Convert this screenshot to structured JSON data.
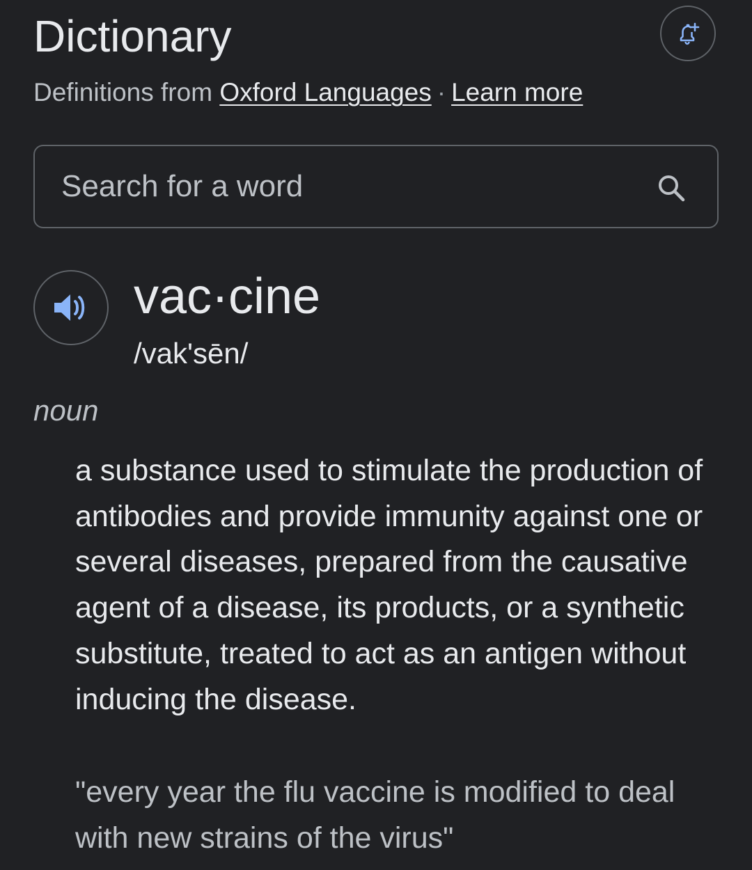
{
  "header": {
    "title": "Dictionary",
    "alert_icon": "bell-plus-icon"
  },
  "source": {
    "prefix": "Definitions from",
    "provider_link": "Oxford Languages",
    "separator": "·",
    "learn_more_link": "Learn more"
  },
  "search": {
    "placeholder": "Search for a word",
    "value": "",
    "icon": "search-icon"
  },
  "entry": {
    "audio_icon": "speaker-icon",
    "word": "vac·cine",
    "phonetic": "/vak'sēn/",
    "part_of_speech": "noun",
    "definition": "a substance used to stimulate the production of antibodies and provide immunity against one or several diseases, prepared from the causative agent of a disease, its products, or a synthetic substitute, treated to act as an antigen without inducing the disease.",
    "example": "\"every year the flu vaccine is modified to deal with new strains of the virus\""
  },
  "colors": {
    "background": "#202124",
    "text_primary": "#e8eaed",
    "text_secondary": "#bdc1c6",
    "border": "#5f6368",
    "accent_blue": "#8ab4f8"
  }
}
